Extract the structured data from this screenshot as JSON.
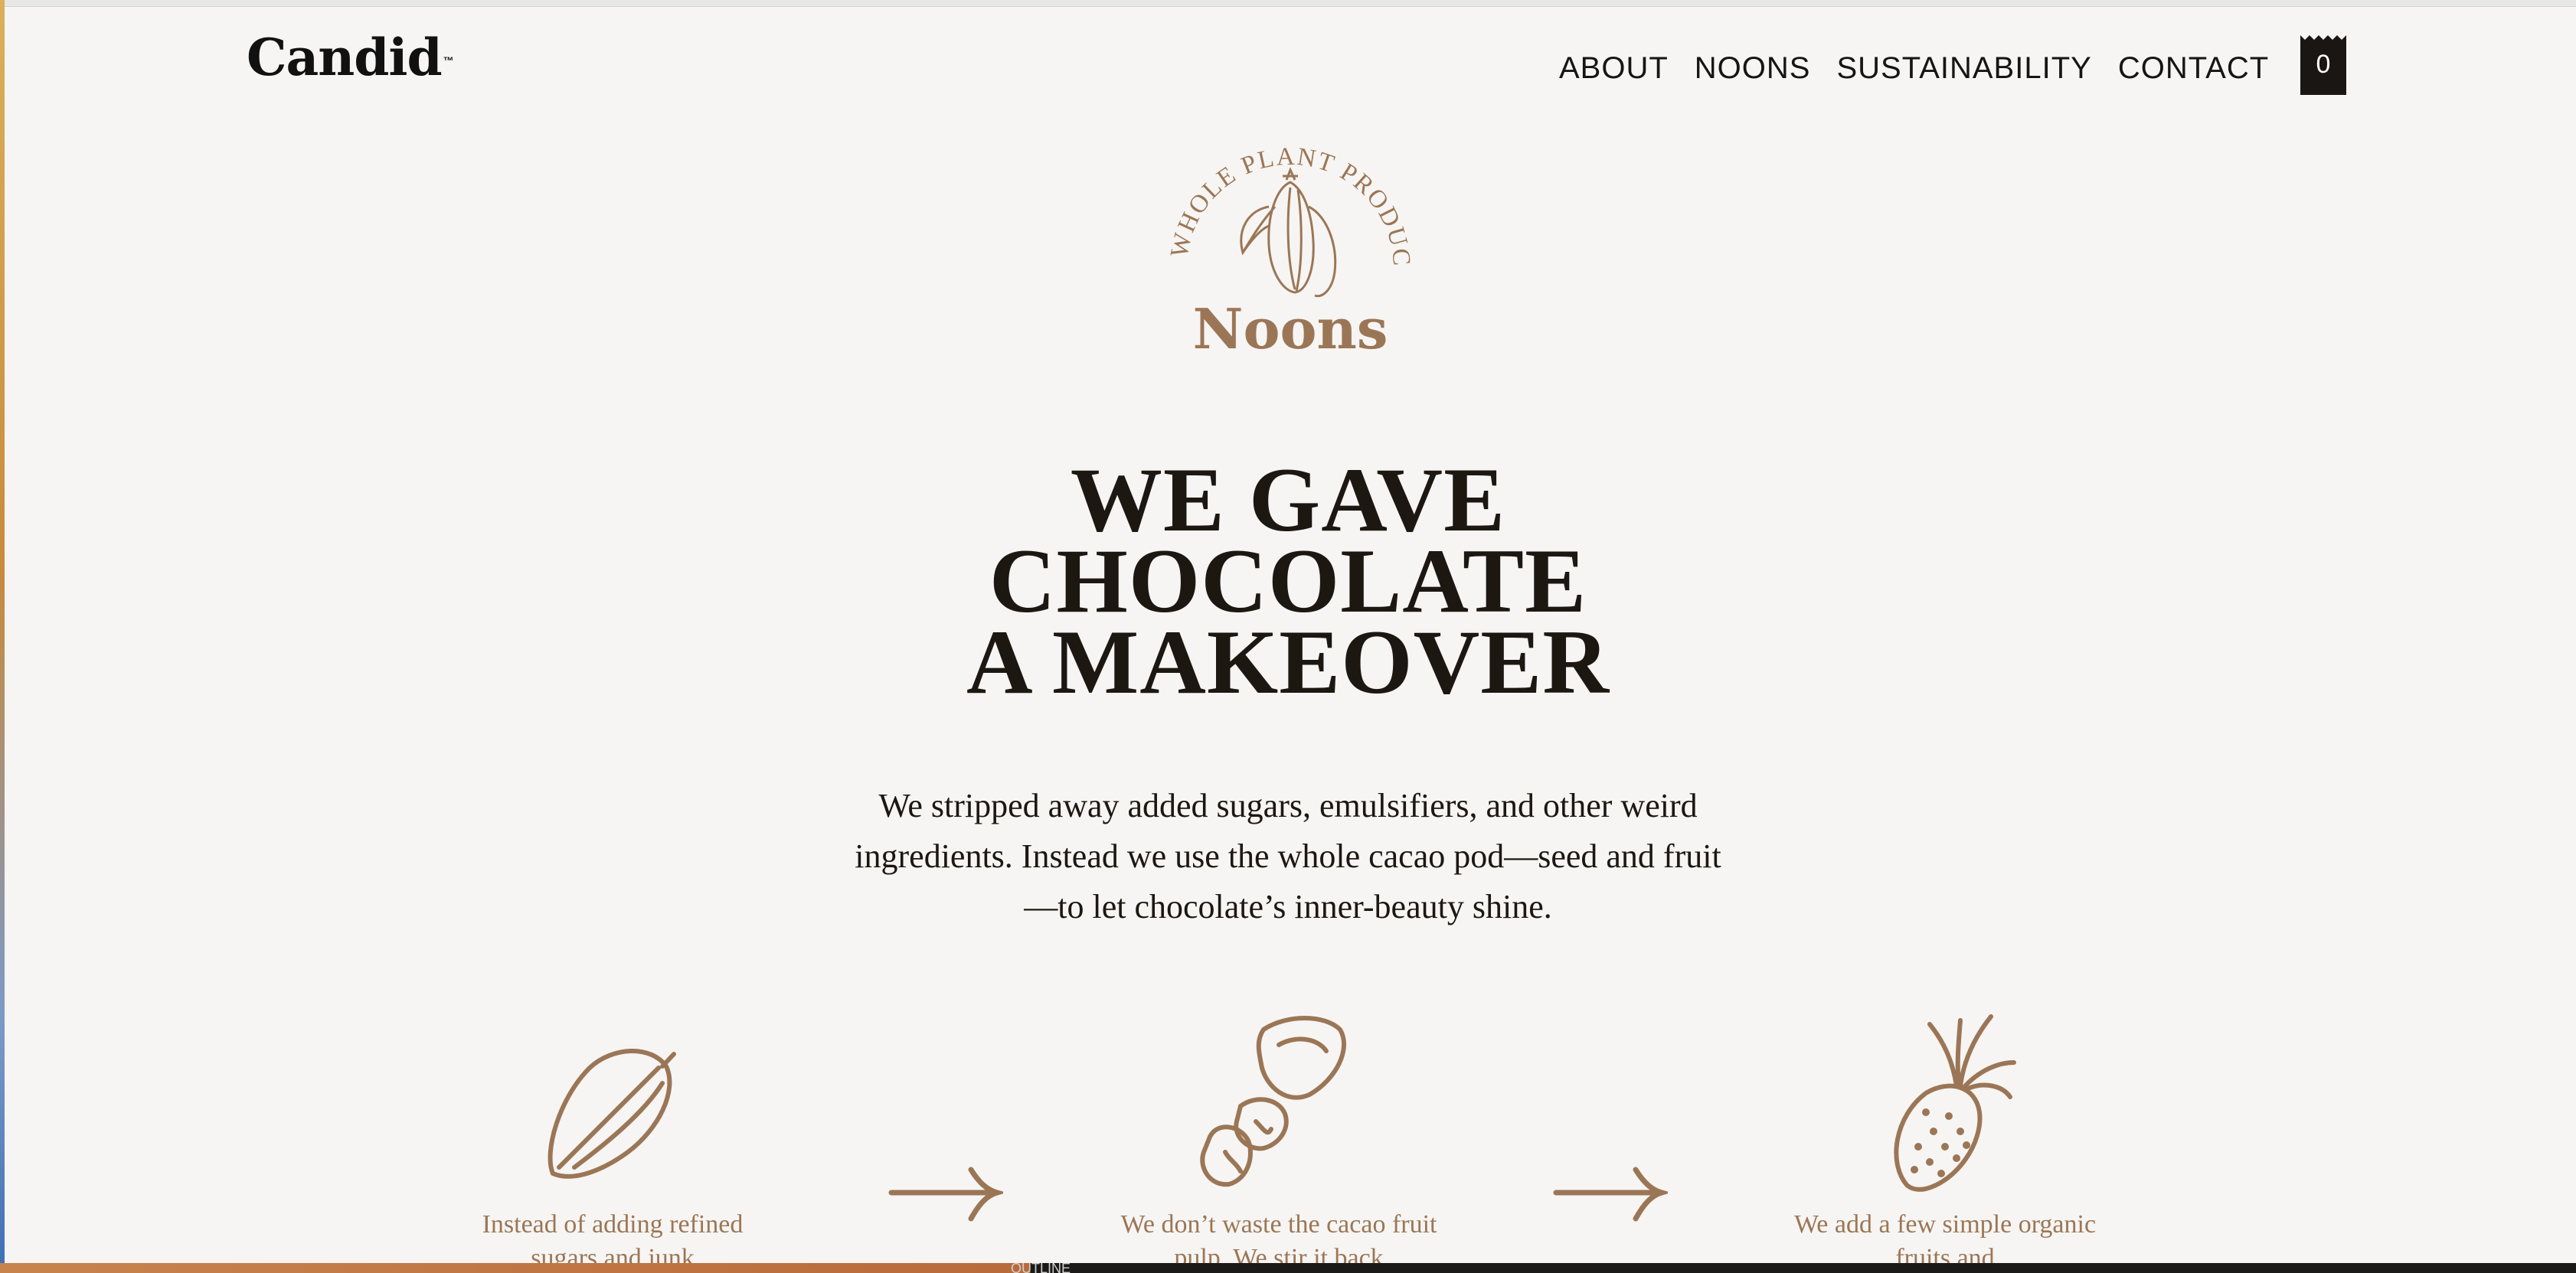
{
  "brand": {
    "name": "Candid",
    "trademark": "™"
  },
  "nav": {
    "items": [
      {
        "label": "ABOUT"
      },
      {
        "label": "NOONS"
      },
      {
        "label": "SUSTAINABILITY"
      },
      {
        "label": "CONTACT"
      }
    ],
    "cart_count": "0"
  },
  "badge": {
    "arc_text": "A WHOLE PLANT PRODUCT",
    "product_name": "Noons"
  },
  "hero": {
    "headline_line1": "WE GAVE",
    "headline_line2": "CHOCOLATE",
    "headline_line3": "A MAKEOVER",
    "intro": "We stripped away added sugars, emulsifiers, and other weird ingredients. Instead we use the whole cacao pod—seed and fruit—to let chocolate’s inner-beauty shine."
  },
  "steps": [
    {
      "icon": "cacao-pod-icon",
      "caption": "Instead of adding refined sugars and junk"
    },
    {
      "icon": "cacao-fruit-icon",
      "caption": "We don’t waste the cacao fruit pulp. We stir it back"
    },
    {
      "icon": "pineapple-icon",
      "caption": "We add a few simple organic fruits and"
    }
  ],
  "bottom_bar": {
    "ghost_text": "OUTLINE"
  },
  "colors": {
    "background": "#f6f5f3",
    "accent_brown": "#9b7656",
    "text_dark": "#1d1712",
    "cart_bg": "#1a1614"
  }
}
